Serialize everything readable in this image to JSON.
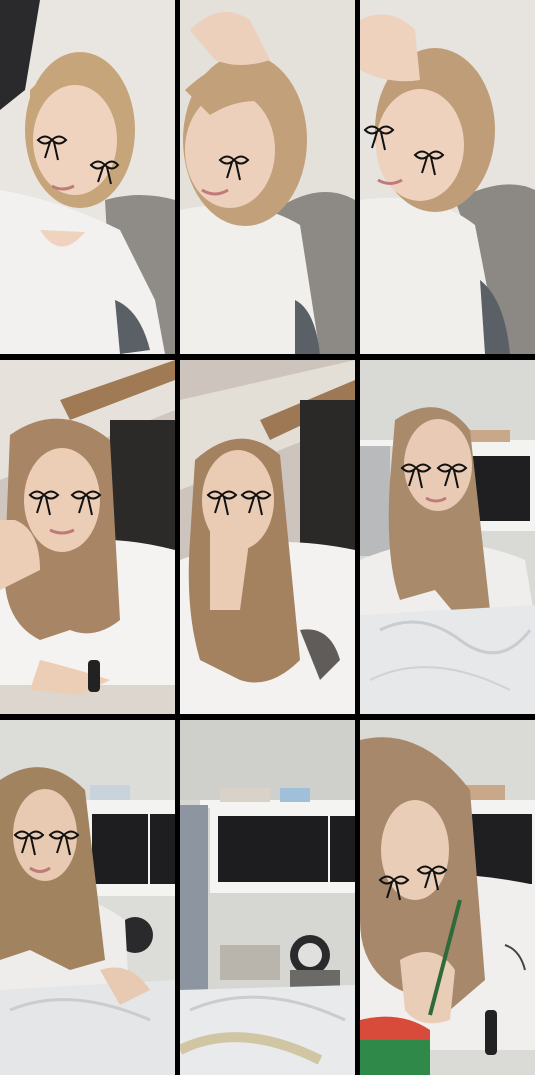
{
  "collage": {
    "rows": 3,
    "columns": 3,
    "tiles": [
      {
        "scene": "lying-on-pillow",
        "decoration": "bow-tear-stickers",
        "colors": {
          "bg": "#e9e6e1",
          "shirt": "#f2f1ef",
          "hair": "#c7a57a",
          "skin": "#efd3be",
          "blanket": "#8f8c88"
        }
      },
      {
        "scene": "hand-on-forehead",
        "decoration": "bow-tear-stickers",
        "colors": {
          "bg": "#e4e1db",
          "shirt": "#f0efec",
          "hair": "#c2a07a",
          "skin": "#ecd0bb",
          "blanket": "#8d8a86"
        }
      },
      {
        "scene": "hand-on-head-lying",
        "decoration": "bow-tear-stickers",
        "colors": {
          "bg": "#e7e3de",
          "shirt": "#f0efec",
          "hair": "#bf9d78",
          "skin": "#efd2bd",
          "blanket": "#8c8985"
        }
      },
      {
        "scene": "chin-on-hand",
        "decoration": "bow-tear-stickers",
        "colors": {
          "bg": "#cfc7bf",
          "wall": "#e6e1da",
          "wood": "#a07a55",
          "shirt": "#f4f3f1",
          "hair": "#a88565",
          "skin": "#eccdb6"
        }
      },
      {
        "scene": "hand-over-mouth",
        "decoration": "bow-tear-stickers",
        "colors": {
          "bg": "#cdc5bd",
          "wall": "#e3ded6",
          "wood": "#9e7854",
          "shirt": "#f3f2f0",
          "hair": "#a5825f",
          "skin": "#eacbb4"
        }
      },
      {
        "scene": "shelf-background-plastic",
        "decoration": "bow-tear-stickers",
        "colors": {
          "bg": "#d9d9d6",
          "shelf": "#f3f3f1",
          "dark": "#1f1f21",
          "shirt": "#efeeec",
          "hair": "#a98b6c",
          "skin": "#e9cbb5",
          "plastic": "#e6e8ea"
        }
      },
      {
        "scene": "unwrapping-plastic",
        "decoration": "bow-tear-stickers",
        "colors": {
          "bg": "#dcdcd9",
          "shelf": "#f3f3f1",
          "dark": "#1e1e20",
          "shirt": "#eeedeb",
          "hair": "#a2835f",
          "skin": "#e8cab3",
          "plastic": "#e4e6e8"
        }
      },
      {
        "scene": "room-view-plastic",
        "decoration": "none",
        "colors": {
          "bg": "#d6d6d3",
          "shelf": "#f4f4f2",
          "dark": "#1d1d1f",
          "plastic": "#e9eaec",
          "clutter": "#8d96a0"
        }
      },
      {
        "scene": "writing-on-container",
        "decoration": "bow-tear-stickers",
        "colors": {
          "bg": "#dadad7",
          "shelf": "#f3f3f1",
          "dark": "#1f1f21",
          "shirt": "#f0efed",
          "hair": "#a7886a",
          "skin": "#eacdb7",
          "container": "#2f8a4a"
        }
      }
    ]
  }
}
